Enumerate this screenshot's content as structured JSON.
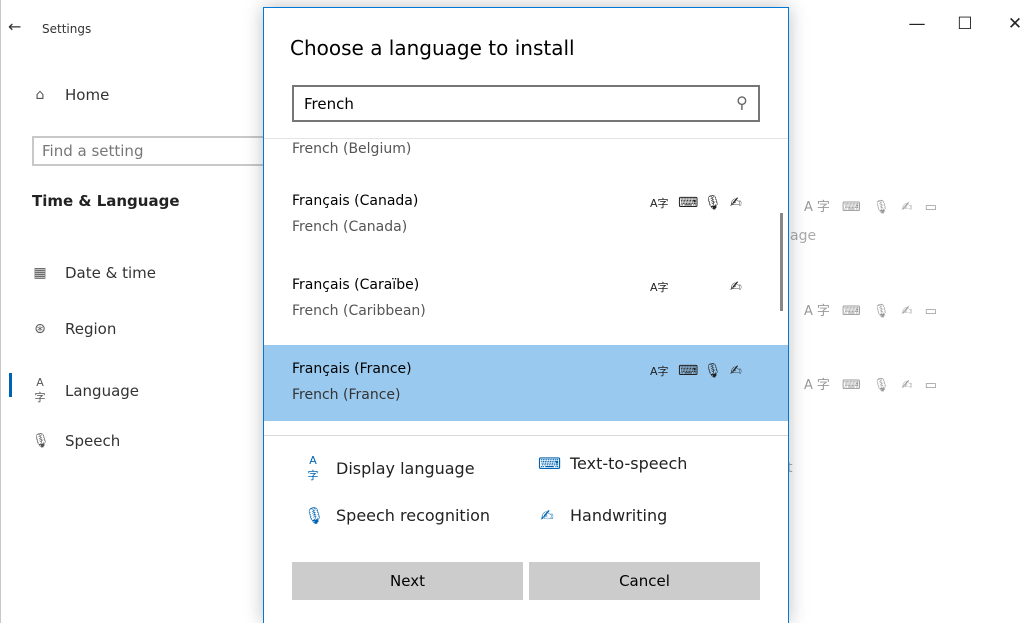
{
  "window": {
    "title": "Settings",
    "back_icon": "←",
    "minimize": "—",
    "maximize": "☐",
    "close": "✕"
  },
  "nav": {
    "home": "Home",
    "search_placeholder": "Find a setting",
    "section": "Time & Language",
    "items": [
      {
        "label": "Date & time",
        "icon": "calendar-clock-icon"
      },
      {
        "label": "Region",
        "icon": "globe-icon"
      },
      {
        "label": "Language",
        "icon": "language-icon"
      },
      {
        "label": "Speech",
        "icon": "microphone-icon"
      }
    ],
    "active": "Language"
  },
  "background": {
    "partial_text_1": "age",
    "partial_text_2": "t"
  },
  "dialog": {
    "title": "Choose a language to install",
    "search_value": "French",
    "languages": [
      {
        "native": "",
        "english": "French (Belgium)",
        "features": []
      },
      {
        "native": "Français (Canada)",
        "english": "French (Canada)",
        "features": [
          "display",
          "tts",
          "speech",
          "handwriting"
        ]
      },
      {
        "native": "Français (Caraïbe)",
        "english": "French (Caribbean)",
        "features": [
          "display",
          "handwriting"
        ]
      },
      {
        "native": "Français (France)",
        "english": "French (France)",
        "features": [
          "display",
          "tts",
          "speech",
          "handwriting"
        ],
        "selected": true
      }
    ],
    "legend": {
      "display": "Display language",
      "tts": "Text-to-speech",
      "speech": "Speech recognition",
      "handwriting": "Handwriting"
    },
    "buttons": {
      "next": "Next",
      "cancel": "Cancel"
    }
  },
  "colors": {
    "accent": "#0078d7",
    "selection": "#99c9ef",
    "button": "#cccccc"
  }
}
